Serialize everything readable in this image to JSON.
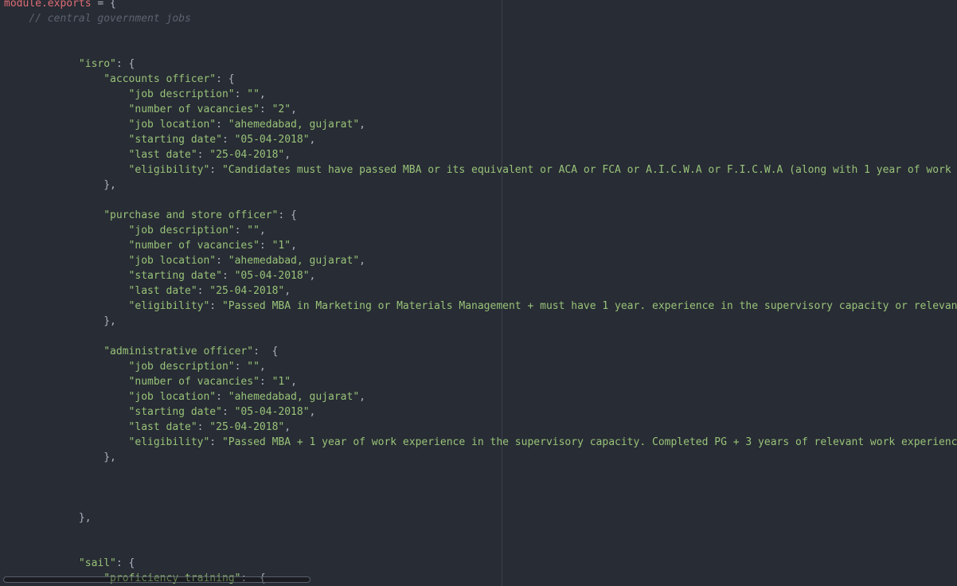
{
  "editor": {
    "lines": [
      [
        {
          "t": "module.exports",
          "c": "kw"
        },
        {
          "t": " = {",
          "c": "punct"
        }
      ],
      [
        {
          "t": "    ",
          "c": "punct"
        },
        {
          "t": "// central government jobs",
          "c": "cmt"
        }
      ],
      [],
      [],
      [
        {
          "t": "            ",
          "c": "punct"
        },
        {
          "t": "\"isro\"",
          "c": "str"
        },
        {
          "t": ": {",
          "c": "punct"
        }
      ],
      [
        {
          "t": "                ",
          "c": "punct"
        },
        {
          "t": "\"accounts officer\"",
          "c": "str"
        },
        {
          "t": ": {",
          "c": "punct"
        }
      ],
      [
        {
          "t": "                    ",
          "c": "punct"
        },
        {
          "t": "\"job description\"",
          "c": "str"
        },
        {
          "t": ": ",
          "c": "punct"
        },
        {
          "t": "\"\"",
          "c": "str"
        },
        {
          "t": ",",
          "c": "punct"
        }
      ],
      [
        {
          "t": "                    ",
          "c": "punct"
        },
        {
          "t": "\"number of vacancies\"",
          "c": "str"
        },
        {
          "t": ": ",
          "c": "punct"
        },
        {
          "t": "\"2\"",
          "c": "str"
        },
        {
          "t": ",",
          "c": "punct"
        }
      ],
      [
        {
          "t": "                    ",
          "c": "punct"
        },
        {
          "t": "\"job location\"",
          "c": "str"
        },
        {
          "t": ": ",
          "c": "punct"
        },
        {
          "t": "\"ahemedabad, gujarat\"",
          "c": "str"
        },
        {
          "t": ",",
          "c": "punct"
        }
      ],
      [
        {
          "t": "                    ",
          "c": "punct"
        },
        {
          "t": "\"starting date\"",
          "c": "str"
        },
        {
          "t": ": ",
          "c": "punct"
        },
        {
          "t": "\"05-04-2018\"",
          "c": "str"
        },
        {
          "t": ",",
          "c": "punct"
        }
      ],
      [
        {
          "t": "                    ",
          "c": "punct"
        },
        {
          "t": "\"last date\"",
          "c": "str"
        },
        {
          "t": ": ",
          "c": "punct"
        },
        {
          "t": "\"25-04-2018\"",
          "c": "str"
        },
        {
          "t": ",",
          "c": "punct"
        }
      ],
      [
        {
          "t": "                    ",
          "c": "punct"
        },
        {
          "t": "\"eligibility\"",
          "c": "str"
        },
        {
          "t": ": ",
          "c": "punct"
        },
        {
          "t": "\"Candidates must have passed MBA or its equivalent or ACA or FCA or A.I.C.W.A or F.I.C.W.A (along with 1 year of work",
          "c": "str"
        }
      ],
      [
        {
          "t": "                ",
          "c": "punct"
        },
        {
          "t": "},",
          "c": "punct"
        }
      ],
      [],
      [
        {
          "t": "                ",
          "c": "punct"
        },
        {
          "t": "\"purchase and store officer\"",
          "c": "str"
        },
        {
          "t": ": {",
          "c": "punct"
        }
      ],
      [
        {
          "t": "                    ",
          "c": "punct"
        },
        {
          "t": "\"job description\"",
          "c": "str"
        },
        {
          "t": ": ",
          "c": "punct"
        },
        {
          "t": "\"\"",
          "c": "str"
        },
        {
          "t": ",",
          "c": "punct"
        }
      ],
      [
        {
          "t": "                    ",
          "c": "punct"
        },
        {
          "t": "\"number of vacancies\"",
          "c": "str"
        },
        {
          "t": ": ",
          "c": "punct"
        },
        {
          "t": "\"1\"",
          "c": "str"
        },
        {
          "t": ",",
          "c": "punct"
        }
      ],
      [
        {
          "t": "                    ",
          "c": "punct"
        },
        {
          "t": "\"job location\"",
          "c": "str"
        },
        {
          "t": ": ",
          "c": "punct"
        },
        {
          "t": "\"ahemedabad, gujarat\"",
          "c": "str"
        },
        {
          "t": ",",
          "c": "punct"
        }
      ],
      [
        {
          "t": "                    ",
          "c": "punct"
        },
        {
          "t": "\"starting date\"",
          "c": "str"
        },
        {
          "t": ": ",
          "c": "punct"
        },
        {
          "t": "\"05-04-2018\"",
          "c": "str"
        },
        {
          "t": ",",
          "c": "punct"
        }
      ],
      [
        {
          "t": "                    ",
          "c": "punct"
        },
        {
          "t": "\"last date\"",
          "c": "str"
        },
        {
          "t": ": ",
          "c": "punct"
        },
        {
          "t": "\"25-04-2018\"",
          "c": "str"
        },
        {
          "t": ",",
          "c": "punct"
        }
      ],
      [
        {
          "t": "                    ",
          "c": "punct"
        },
        {
          "t": "\"eligibility\"",
          "c": "str"
        },
        {
          "t": ": ",
          "c": "punct"
        },
        {
          "t": "\"Passed MBA in Marketing or Materials Management + must have 1 year. experience in the supervisory capacity or relevan",
          "c": "str"
        }
      ],
      [
        {
          "t": "                ",
          "c": "punct"
        },
        {
          "t": "},",
          "c": "punct"
        }
      ],
      [],
      [
        {
          "t": "                ",
          "c": "punct"
        },
        {
          "t": "\"administrative officer\"",
          "c": "str"
        },
        {
          "t": ":  {",
          "c": "punct"
        }
      ],
      [
        {
          "t": "                    ",
          "c": "punct"
        },
        {
          "t": "\"job description\"",
          "c": "str"
        },
        {
          "t": ": ",
          "c": "punct"
        },
        {
          "t": "\"\"",
          "c": "str"
        },
        {
          "t": ",",
          "c": "punct"
        }
      ],
      [
        {
          "t": "                    ",
          "c": "punct"
        },
        {
          "t": "\"number of vacancies\"",
          "c": "str"
        },
        {
          "t": ": ",
          "c": "punct"
        },
        {
          "t": "\"1\"",
          "c": "str"
        },
        {
          "t": ",",
          "c": "punct"
        }
      ],
      [
        {
          "t": "                    ",
          "c": "punct"
        },
        {
          "t": "\"job location\"",
          "c": "str"
        },
        {
          "t": ": ",
          "c": "punct"
        },
        {
          "t": "\"ahemedabad, gujarat\"",
          "c": "str"
        },
        {
          "t": ",",
          "c": "punct"
        }
      ],
      [
        {
          "t": "                    ",
          "c": "punct"
        },
        {
          "t": "\"starting date\"",
          "c": "str"
        },
        {
          "t": ": ",
          "c": "punct"
        },
        {
          "t": "\"05-04-2018\"",
          "c": "str"
        },
        {
          "t": ",",
          "c": "punct"
        }
      ],
      [
        {
          "t": "                    ",
          "c": "punct"
        },
        {
          "t": "\"last date\"",
          "c": "str"
        },
        {
          "t": ": ",
          "c": "punct"
        },
        {
          "t": "\"25-04-2018\"",
          "c": "str"
        },
        {
          "t": ",",
          "c": "punct"
        }
      ],
      [
        {
          "t": "                    ",
          "c": "punct"
        },
        {
          "t": "\"eligibility\"",
          "c": "str"
        },
        {
          "t": ": ",
          "c": "punct"
        },
        {
          "t": "\"Passed MBA + 1 year of work experience in the supervisory capacity. Completed PG + 3 years of relevant work experienc",
          "c": "str"
        }
      ],
      [
        {
          "t": "                ",
          "c": "punct"
        },
        {
          "t": "},",
          "c": "punct"
        }
      ],
      [],
      [],
      [],
      [
        {
          "t": "            ",
          "c": "punct"
        },
        {
          "t": "},",
          "c": "punct"
        }
      ],
      [],
      [],
      [
        {
          "t": "            ",
          "c": "punct"
        },
        {
          "t": "\"sail\"",
          "c": "str"
        },
        {
          "t": ": {",
          "c": "punct"
        }
      ],
      [
        {
          "t": "                ",
          "c": "punct"
        },
        {
          "t": "\"proficiency training\"",
          "c": "str"
        },
        {
          "t": ":  {",
          "c": "punct"
        }
      ]
    ]
  },
  "colors": {
    "background": "#282c34",
    "keyword": "#e06c75",
    "string": "#98c379",
    "comment": "#5c6370",
    "punctuation": "#abb2bf"
  }
}
